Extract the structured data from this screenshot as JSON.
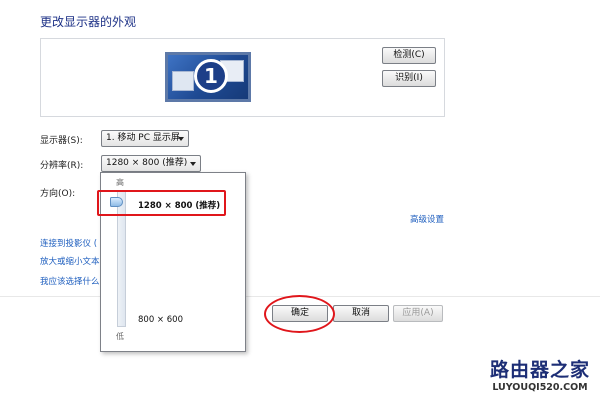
{
  "page_title": "更改显示器的外观",
  "preview": {
    "monitor_number": "1"
  },
  "buttons": {
    "detect": "检测(C)",
    "identify": "识别(I)",
    "ok": "确定",
    "cancel": "取消",
    "apply": "应用(A)"
  },
  "fields": {
    "display_label": "显示器(S):",
    "display_value": "1. 移动 PC 显示屏",
    "resolution_label": "分辨率(R):",
    "resolution_value": "1280 × 800 (推荐)",
    "orientation_label": "方向(O):"
  },
  "links": {
    "advanced": "高级设置",
    "projector": "连接到投影仪 (",
    "zoom": "放大或缩小文本",
    "which": "我应该选择什么"
  },
  "resolution_dropdown": {
    "slider_high": "高",
    "slider_low": "低",
    "option_high": "1280 × 800 (推荐)",
    "option_low": "800 × 600",
    "slider_position": 0.0
  },
  "annotation_colors": {
    "highlight": "#e0161b"
  },
  "watermark": {
    "title": "路由器之家",
    "url": "LUYOUQI520.COM"
  }
}
